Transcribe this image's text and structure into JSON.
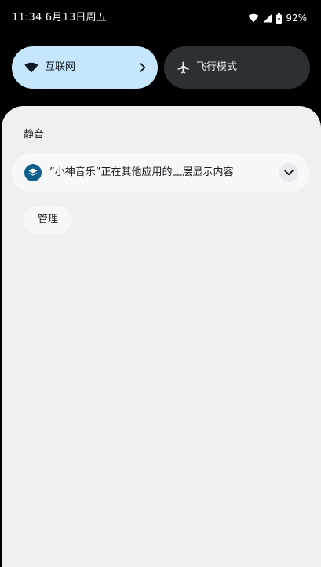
{
  "status_bar": {
    "time_date": "11:34 6月13日周五",
    "battery": "92%",
    "icons": [
      "wifi-icon",
      "signal-icon",
      "battery-icon"
    ]
  },
  "quick_settings": {
    "internet": {
      "label": "互联网",
      "icon": "wifi-icon",
      "active": true
    },
    "airplane": {
      "label": "飞行模式",
      "icon": "airplane-icon",
      "active": false
    }
  },
  "shade": {
    "section_title": "静音",
    "notification": {
      "text": "”小神音乐”正在其他应用的上层显示内容",
      "app_icon": "layers-icon",
      "app_color": "#0d5f8c"
    },
    "manage_label": "管理"
  },
  "colors": {
    "active_tile": "#c5e6fd",
    "inactive_tile": "#2c2f33",
    "panel": "#eff0f2",
    "card": "#f8f8fa"
  }
}
